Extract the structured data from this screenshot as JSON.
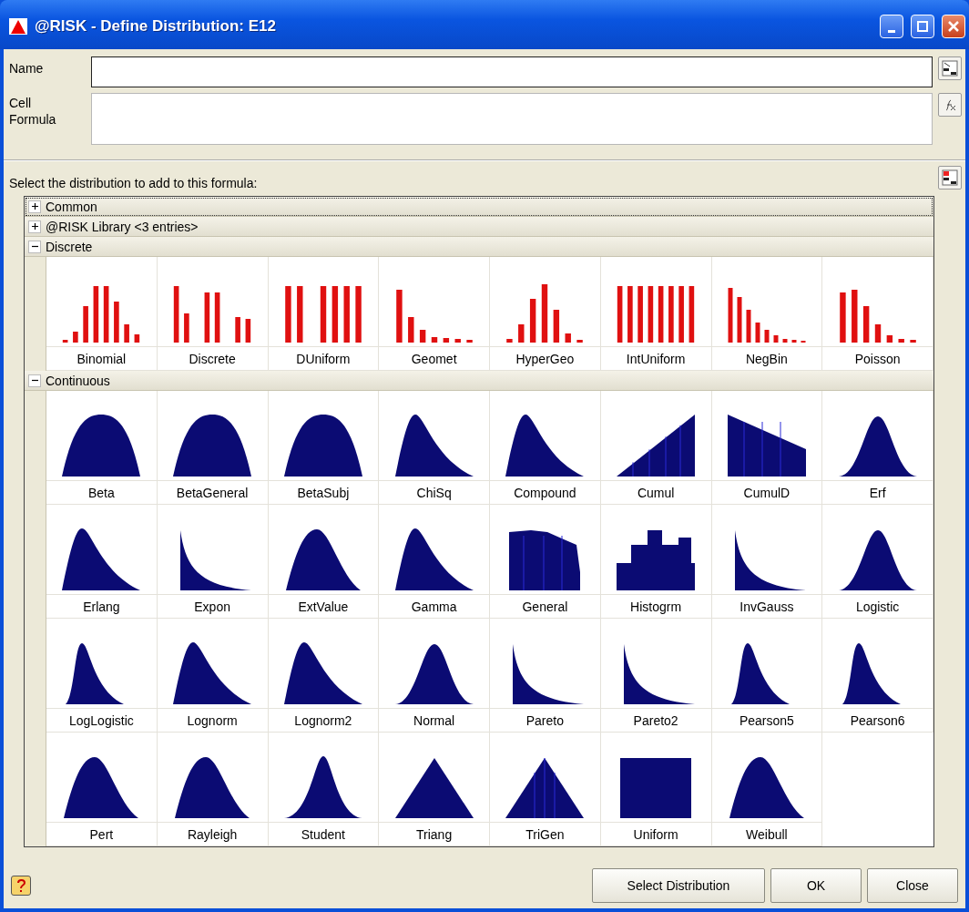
{
  "window": {
    "title": "@RISK - Define Distribution: E12"
  },
  "fields": [
    {
      "label": "Name",
      "kind": "name"
    },
    {
      "label": "Cell Formula",
      "kind": "formula"
    }
  ],
  "prompt": "Select the distribution to add to this formula:",
  "groups": [
    {
      "label": "Common",
      "expanded": false,
      "selected": true
    },
    {
      "label": "@RISK Library <3 entries>",
      "expanded": false,
      "selected": false
    },
    {
      "label": "Discrete",
      "expanded": true,
      "selected": false,
      "items": [
        {
          "name": "Binomial",
          "kind": "binomial"
        },
        {
          "name": "Discrete",
          "kind": "discrete"
        },
        {
          "name": "DUniform",
          "kind": "duniform"
        },
        {
          "name": "Geomet",
          "kind": "geomet"
        },
        {
          "name": "HyperGeo",
          "kind": "hypergeo"
        },
        {
          "name": "IntUniform",
          "kind": "intuniform"
        },
        {
          "name": "NegBin",
          "kind": "negbin"
        },
        {
          "name": "Poisson",
          "kind": "poisson"
        }
      ]
    },
    {
      "label": "Continuous",
      "expanded": true,
      "selected": false,
      "items": [
        {
          "name": "Beta",
          "kind": "bell"
        },
        {
          "name": "BetaGeneral",
          "kind": "bell"
        },
        {
          "name": "BetaSubj",
          "kind": "bell"
        },
        {
          "name": "ChiSq",
          "kind": "skew"
        },
        {
          "name": "Compound",
          "kind": "skew"
        },
        {
          "name": "Cumul",
          "kind": "cumul"
        },
        {
          "name": "CumulD",
          "kind": "cumuld"
        },
        {
          "name": "Erf",
          "kind": "peak"
        },
        {
          "name": "Erlang",
          "kind": "skew"
        },
        {
          "name": "Expon",
          "kind": "steep"
        },
        {
          "name": "ExtValue",
          "kind": "hump"
        },
        {
          "name": "Gamma",
          "kind": "skew"
        },
        {
          "name": "General",
          "kind": "general"
        },
        {
          "name": "Histogrm",
          "kind": "histogram"
        },
        {
          "name": "InvGauss",
          "kind": "steep"
        },
        {
          "name": "Logistic",
          "kind": "peak"
        },
        {
          "name": "LogLogistic",
          "kind": "sharp"
        },
        {
          "name": "Lognorm",
          "kind": "skew"
        },
        {
          "name": "Lognorm2",
          "kind": "skew"
        },
        {
          "name": "Normal",
          "kind": "peak"
        },
        {
          "name": "Pareto",
          "kind": "steep"
        },
        {
          "name": "Pareto2",
          "kind": "steep"
        },
        {
          "name": "Pearson5",
          "kind": "sharp"
        },
        {
          "name": "Pearson6",
          "kind": "sharp"
        },
        {
          "name": "Pert",
          "kind": "hump"
        },
        {
          "name": "Rayleigh",
          "kind": "hump"
        },
        {
          "name": "Student",
          "kind": "spike"
        },
        {
          "name": "Triang",
          "kind": "triangle"
        },
        {
          "name": "TriGen",
          "kind": "trigen"
        },
        {
          "name": "Uniform",
          "kind": "uniform"
        },
        {
          "name": "Weibull",
          "kind": "hump"
        }
      ]
    }
  ],
  "buttons": [
    "Select Distribution",
    "OK",
    "Close"
  ]
}
